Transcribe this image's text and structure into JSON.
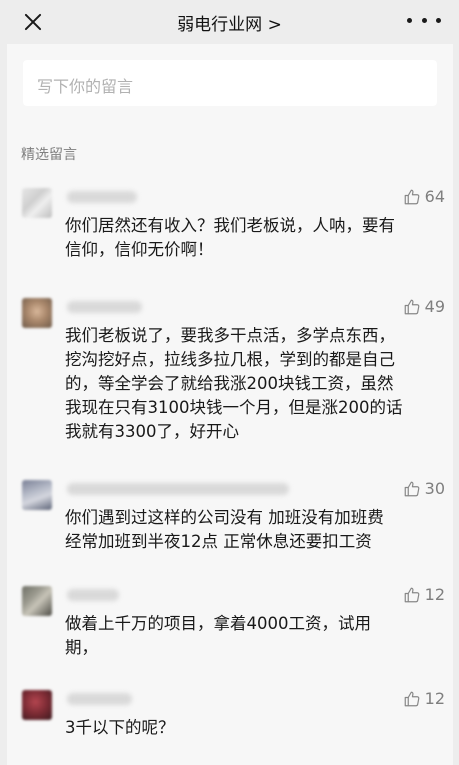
{
  "header": {
    "title": "弱电行业网 >"
  },
  "write_box": {
    "placeholder": "写下你的留言"
  },
  "section": {
    "label": "精选留言"
  },
  "comments": [
    {
      "likes": "64",
      "lines": [
        "你们居然还有收入？我们老板说，人呐，要有",
        "信仰，信仰无价啊！"
      ]
    },
    {
      "likes": "49",
      "lines": [
        "我们老板说了，要我多干点活，多学点东西，",
        "挖沟挖好点，拉线多拉几根，学到的都是自己",
        "的，等全学会了就给我涨200块钱工资，虽然",
        "我现在只有3100块钱一个月，但是涨200的话",
        "我就有3300了，好开心"
      ]
    },
    {
      "likes": "30",
      "lines": [
        "你们遇到过这样的公司没有 加班没有加班费",
        "经常加班到半夜12点 正常休息还要扣工资"
      ]
    },
    {
      "likes": "12",
      "lines": [
        "做着上千万的项目，拿着4000工资，试用",
        "期，"
      ]
    },
    {
      "likes": "12",
      "lines": [
        "3千以下的呢？"
      ]
    }
  ]
}
